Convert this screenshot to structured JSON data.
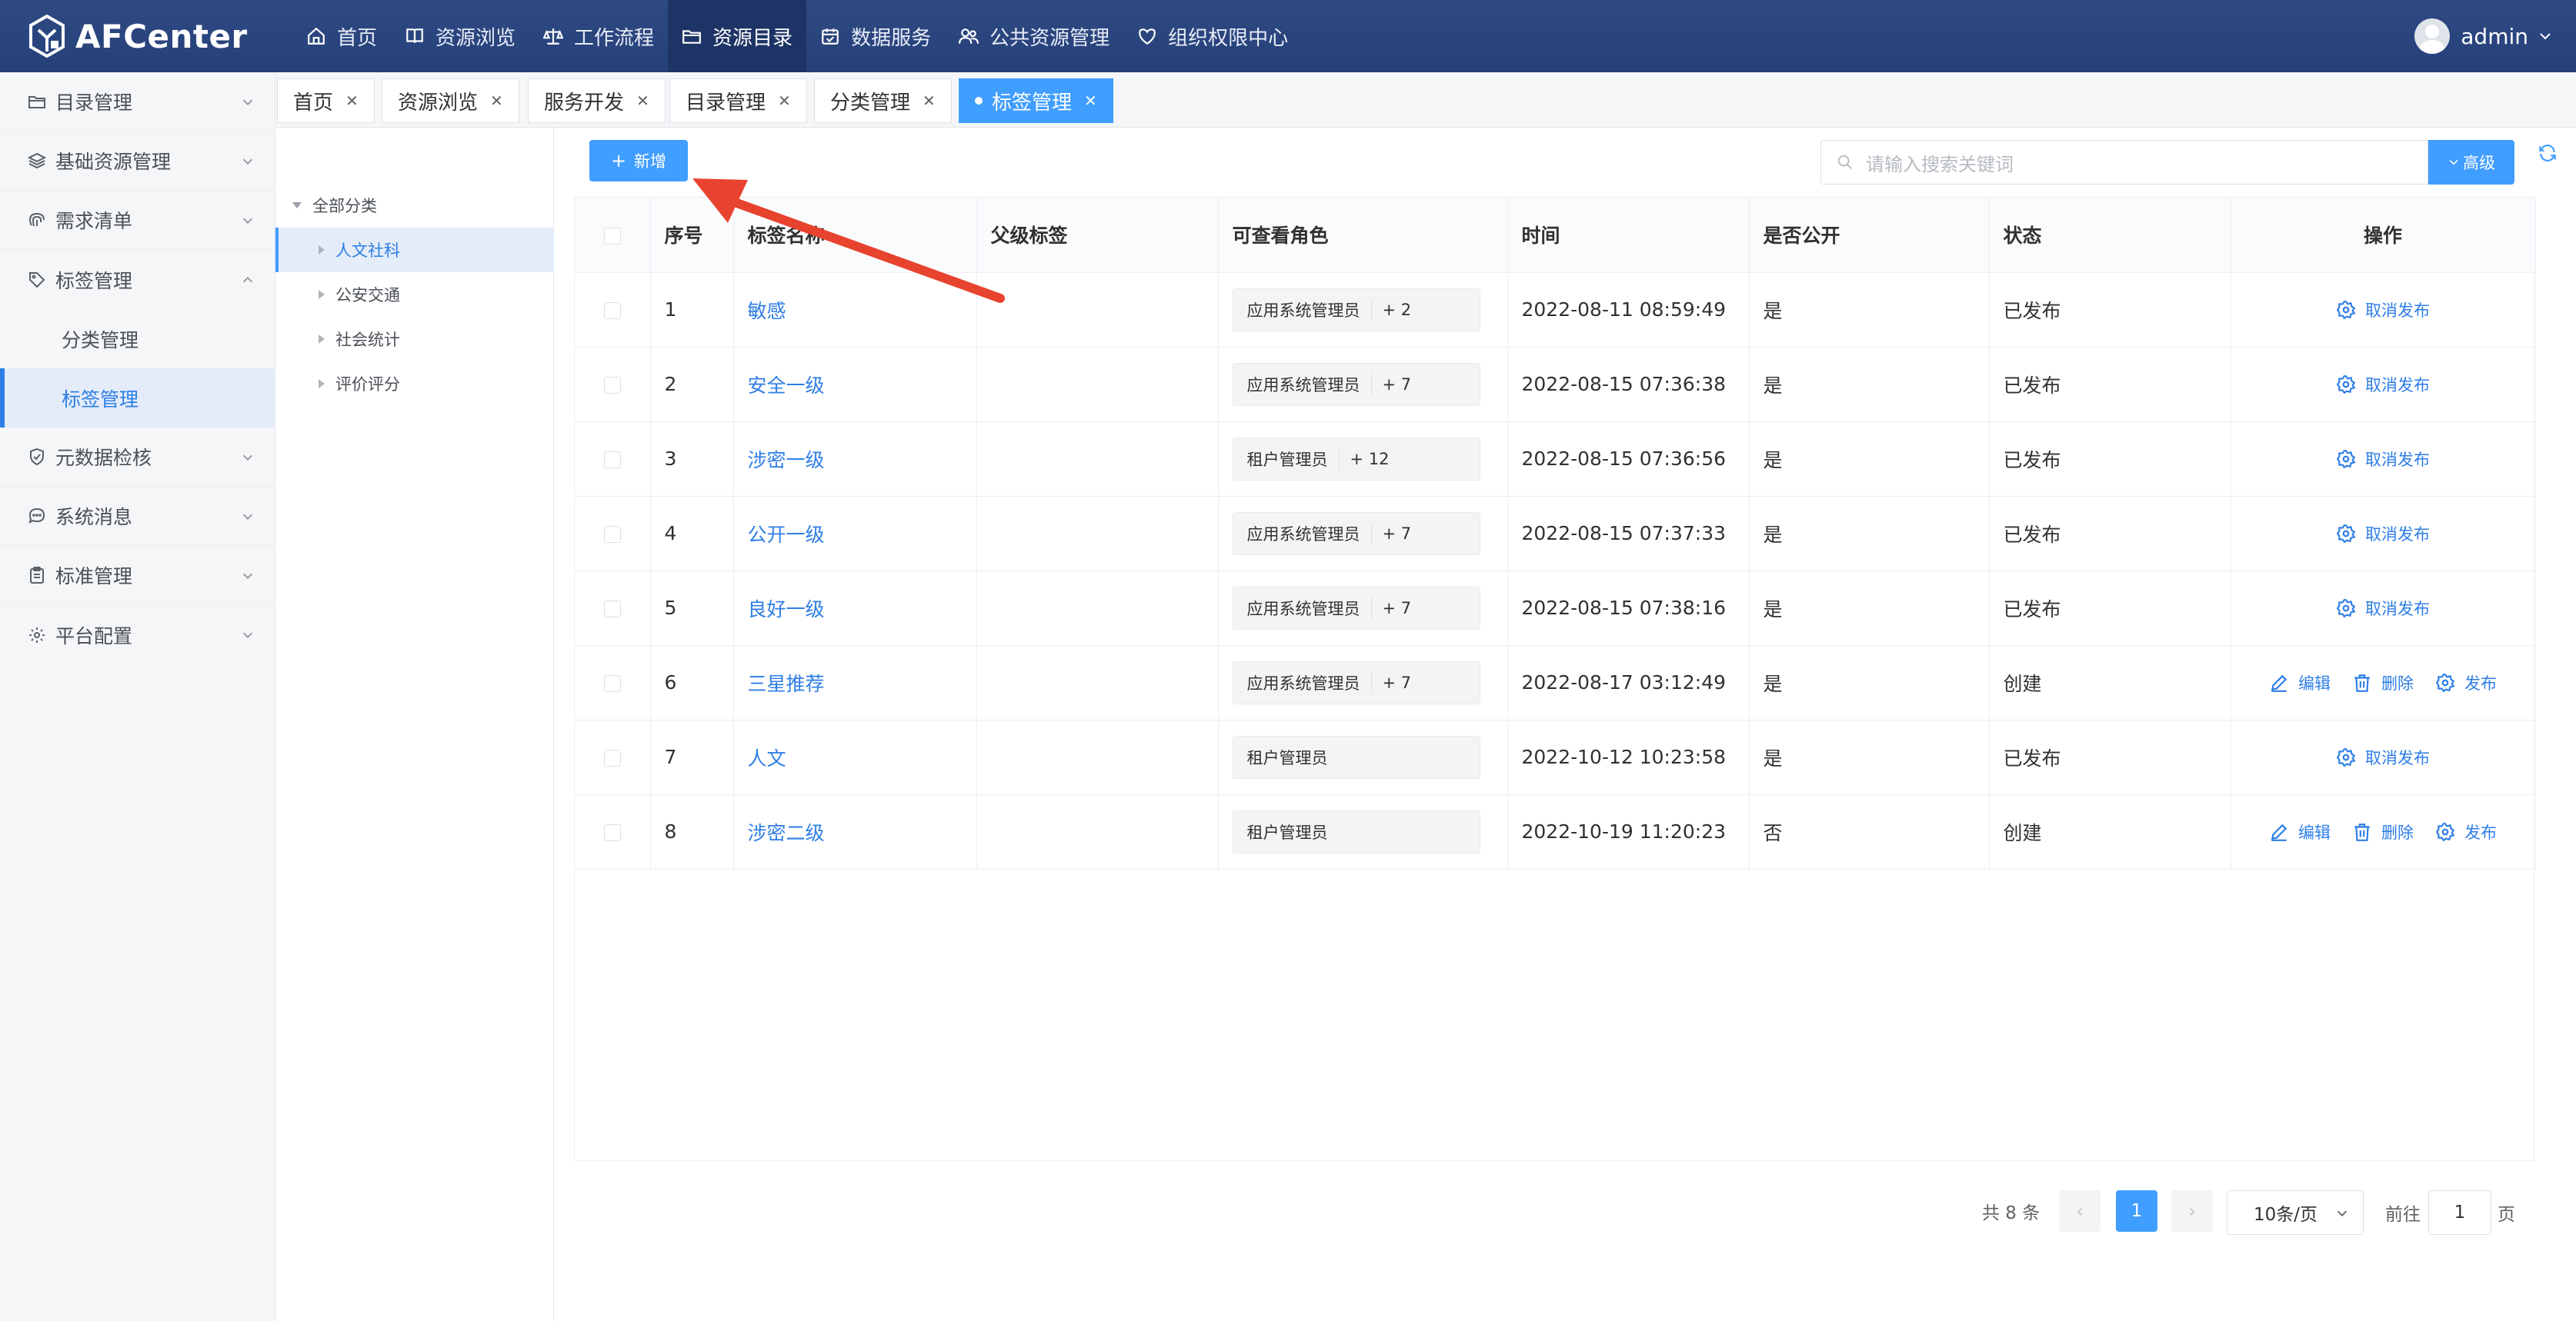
{
  "app": {
    "title": "AFCenter",
    "user": "admin"
  },
  "topnav": [
    {
      "label": "首页",
      "icon": "home-icon"
    },
    {
      "label": "资源浏览",
      "icon": "book-icon"
    },
    {
      "label": "工作流程",
      "icon": "scale-icon"
    },
    {
      "label": "资源目录",
      "icon": "folder-icon",
      "active": true
    },
    {
      "label": "数据服务",
      "icon": "calendar-check-icon"
    },
    {
      "label": "公共资源管理",
      "icon": "users-icon"
    },
    {
      "label": "组织权限中心",
      "icon": "heart-shield-icon"
    }
  ],
  "sidebar": {
    "items": [
      {
        "label": "目录管理",
        "icon": "folder-icon"
      },
      {
        "label": "基础资源管理",
        "icon": "layers-icon"
      },
      {
        "label": "需求清单",
        "icon": "fingerprint-icon"
      },
      {
        "label": "标签管理",
        "icon": "tag-icon",
        "expanded": true
      },
      {
        "label": "元数据检核",
        "icon": "shield-check-icon"
      },
      {
        "label": "系统消息",
        "icon": "chat-icon"
      },
      {
        "label": "标准管理",
        "icon": "clipboard-icon"
      },
      {
        "label": "平台配置",
        "icon": "gear-icon"
      }
    ],
    "sub_items": [
      {
        "label": "分类管理"
      },
      {
        "label": "标签管理",
        "active": true
      }
    ]
  },
  "tabs": [
    {
      "label": "首页"
    },
    {
      "label": "资源浏览"
    },
    {
      "label": "服务开发"
    },
    {
      "label": "目录管理"
    },
    {
      "label": "分类管理"
    },
    {
      "label": "标签管理",
      "active": true
    }
  ],
  "tree": {
    "root": "全部分类",
    "children": [
      "人文社科",
      "公安交通",
      "社会统计",
      "评价评分"
    ],
    "selected": "人文社科"
  },
  "toolbar": {
    "add_label": "新增",
    "search_placeholder": "请输入搜索关键词",
    "advanced_label": "高级"
  },
  "table": {
    "columns": [
      "序号",
      "标签名称",
      "父级标签",
      "可查看角色",
      "时间",
      "是否公开",
      "状态",
      "操作"
    ],
    "rows": [
      {
        "index": "1",
        "name": "敏感",
        "parent": "",
        "role": "应用系统管理员",
        "role_more": "+ 2",
        "time": "2022-08-11 08:59:49",
        "public": "是",
        "status": "已发布",
        "ops": [
          "取消发布"
        ]
      },
      {
        "index": "2",
        "name": "安全一级",
        "parent": "",
        "role": "应用系统管理员",
        "role_more": "+ 7",
        "time": "2022-08-15 07:36:38",
        "public": "是",
        "status": "已发布",
        "ops": [
          "取消发布"
        ]
      },
      {
        "index": "3",
        "name": "涉密一级",
        "parent": "",
        "role": "租户管理员",
        "role_more": "+ 12",
        "time": "2022-08-15 07:36:56",
        "public": "是",
        "status": "已发布",
        "ops": [
          "取消发布"
        ]
      },
      {
        "index": "4",
        "name": "公开一级",
        "parent": "",
        "role": "应用系统管理员",
        "role_more": "+ 7",
        "time": "2022-08-15 07:37:33",
        "public": "是",
        "status": "已发布",
        "ops": [
          "取消发布"
        ]
      },
      {
        "index": "5",
        "name": "良好一级",
        "parent": "",
        "role": "应用系统管理员",
        "role_more": "+ 7",
        "time": "2022-08-15 07:38:16",
        "public": "是",
        "status": "已发布",
        "ops": [
          "取消发布"
        ]
      },
      {
        "index": "6",
        "name": "三星推荐",
        "parent": "",
        "role": "应用系统管理员",
        "role_more": "+ 7",
        "time": "2022-08-17 03:12:49",
        "public": "是",
        "status": "创建",
        "ops": [
          "编辑",
          "删除",
          "发布"
        ]
      },
      {
        "index": "7",
        "name": "人文",
        "parent": "",
        "role": "租户管理员",
        "role_more": "",
        "time": "2022-10-12 10:23:58",
        "public": "是",
        "status": "已发布",
        "ops": [
          "取消发布"
        ]
      },
      {
        "index": "8",
        "name": "涉密二级",
        "parent": "",
        "role": "租户管理员",
        "role_more": "",
        "time": "2022-10-19 11:20:23",
        "public": "否",
        "status": "创建",
        "ops": [
          "编辑",
          "删除",
          "发布"
        ]
      }
    ]
  },
  "pagination": {
    "total": "共 8 条",
    "current": "1",
    "page_size": "10条/页",
    "goto_label": "前往",
    "goto_value": "1",
    "page_unit": "页"
  },
  "colors": {
    "primary": "#409eff",
    "header": "#2b4479",
    "link": "#2e7ee6",
    "annotation": "#e8432e"
  }
}
